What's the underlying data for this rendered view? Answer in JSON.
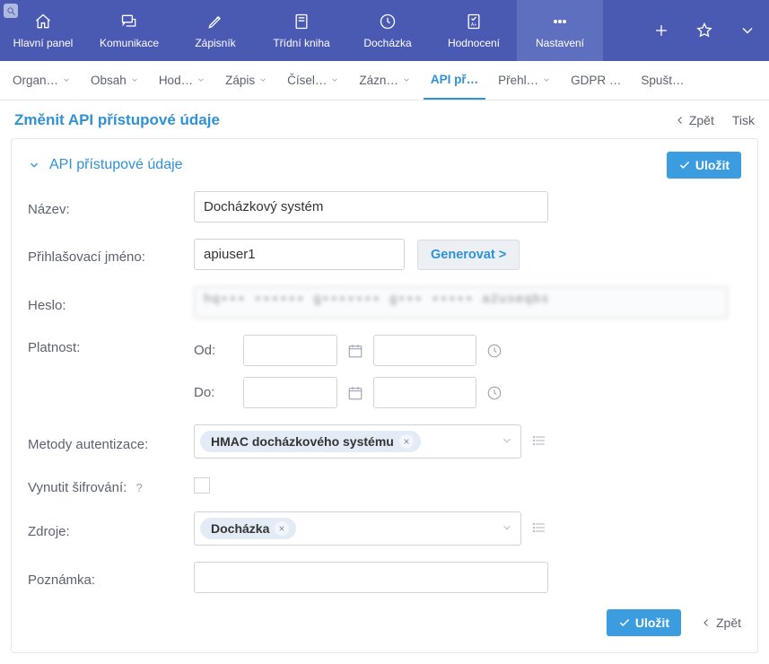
{
  "topnav": {
    "items": [
      {
        "label": "Hlavní panel",
        "icon": "home"
      },
      {
        "label": "Komunikace",
        "icon": "chat"
      },
      {
        "label": "Zápisník",
        "icon": "pencil"
      },
      {
        "label": "Třídní kniha",
        "icon": "book"
      },
      {
        "label": "Docházka",
        "icon": "clock"
      },
      {
        "label": "Hodnocení",
        "icon": "grade"
      },
      {
        "label": "Nastavení",
        "icon": "dots",
        "active": true
      }
    ]
  },
  "subtabs": {
    "items": [
      {
        "label": "Organ…",
        "chev": true
      },
      {
        "label": "Obsah",
        "chev": true
      },
      {
        "label": "Hod…",
        "chev": true
      },
      {
        "label": "Zápis",
        "chev": true
      },
      {
        "label": "Čísel…",
        "chev": true
      },
      {
        "label": "Zázn…",
        "chev": true
      },
      {
        "label": "API př…",
        "chev": false,
        "active": true
      },
      {
        "label": "Přehl…",
        "chev": true
      },
      {
        "label": "GDPR …",
        "chev": false
      },
      {
        "label": "Spušt…",
        "chev": false
      }
    ]
  },
  "title": "Změnit API přístupové údaje",
  "actions": {
    "back": "Zpět",
    "print": "Tisk"
  },
  "panel": {
    "heading": "API přístupové údaje",
    "save": "Uložit",
    "labels": {
      "name": "Název:",
      "login": "Přihlašovací jméno:",
      "password": "Heslo:",
      "validity": "Platnost:",
      "from": "Od:",
      "to": "Do:",
      "auth": "Metody autentizace:",
      "force_enc": "Vynutit šifrování:",
      "sources": "Zdroje:",
      "note": "Poznámka:"
    },
    "values": {
      "name": "Docházkový systém",
      "login": "apiuser1",
      "password_masked": "hq••• •••••• g••••••• g••• ••••• a2useqbs",
      "auth_chip": "HMAC docházkového systému",
      "sources_chip": "Docházka"
    },
    "buttons": {
      "generate": "Generovat >",
      "save": "Uložit",
      "back": "Zpět"
    },
    "help_marker": "?"
  }
}
